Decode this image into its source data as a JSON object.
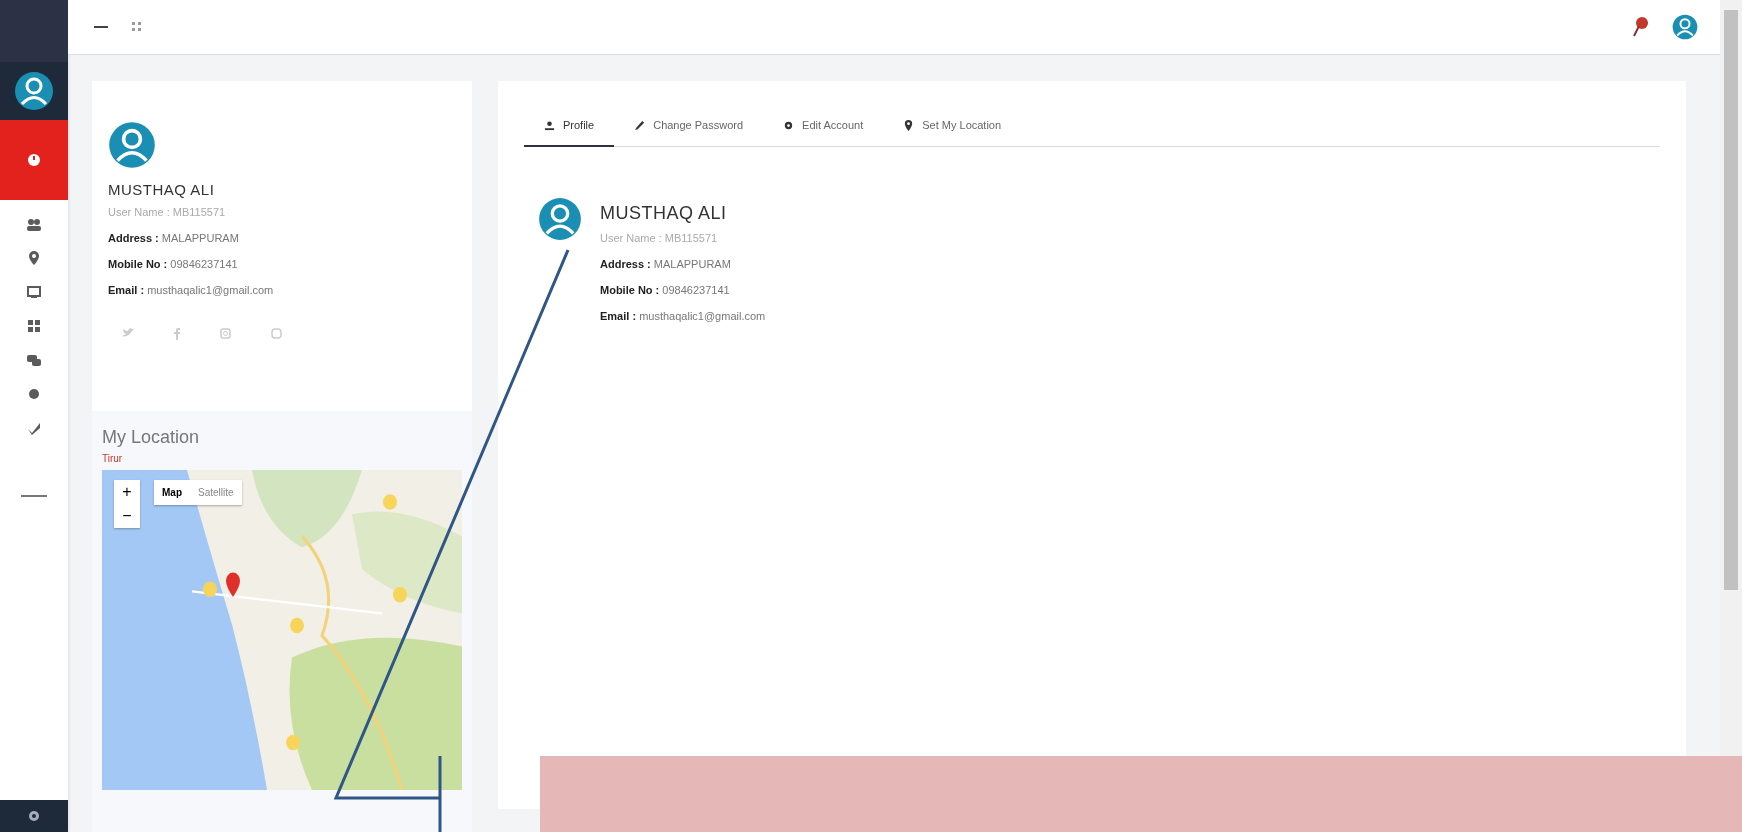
{
  "profile_card": {
    "name": "MUSTHAQ ALI",
    "user_name": "User Name : MB115571",
    "fields": [
      {
        "label": "Address :",
        "value": "MALAPPURAM"
      },
      {
        "label": "Mobile No :",
        "value": "09846237141"
      },
      {
        "label": "Email :",
        "value": "musthaqalic1@gmail.com"
      }
    ]
  },
  "location_card": {
    "title": "My Location",
    "subtitle": "Tirur",
    "map": {
      "kind": "picture",
      "zoom": [
        "+",
        "−"
      ],
      "types": [
        {
          "label": "Map",
          "selected": true
        },
        {
          "label": "Satellite",
          "selected": false
        }
      ]
    }
  },
  "tabs": [
    {
      "label": "Profile",
      "selected": true
    },
    {
      "label": "Change Password",
      "selected": false
    },
    {
      "label": "Edit Account",
      "selected": false
    },
    {
      "label": "Set My Location",
      "selected": false
    }
  ],
  "profile": {
    "name": "MUSTHAQ ALI",
    "user_name": "User Name : MB115571",
    "fields": [
      {
        "label": "Address :",
        "value": "MALAPPURAM"
      },
      {
        "label": "Mobile No :",
        "value": "09846237141"
      },
      {
        "label": "Email :",
        "value": "musthaqalic1@gmail.com"
      }
    ]
  }
}
